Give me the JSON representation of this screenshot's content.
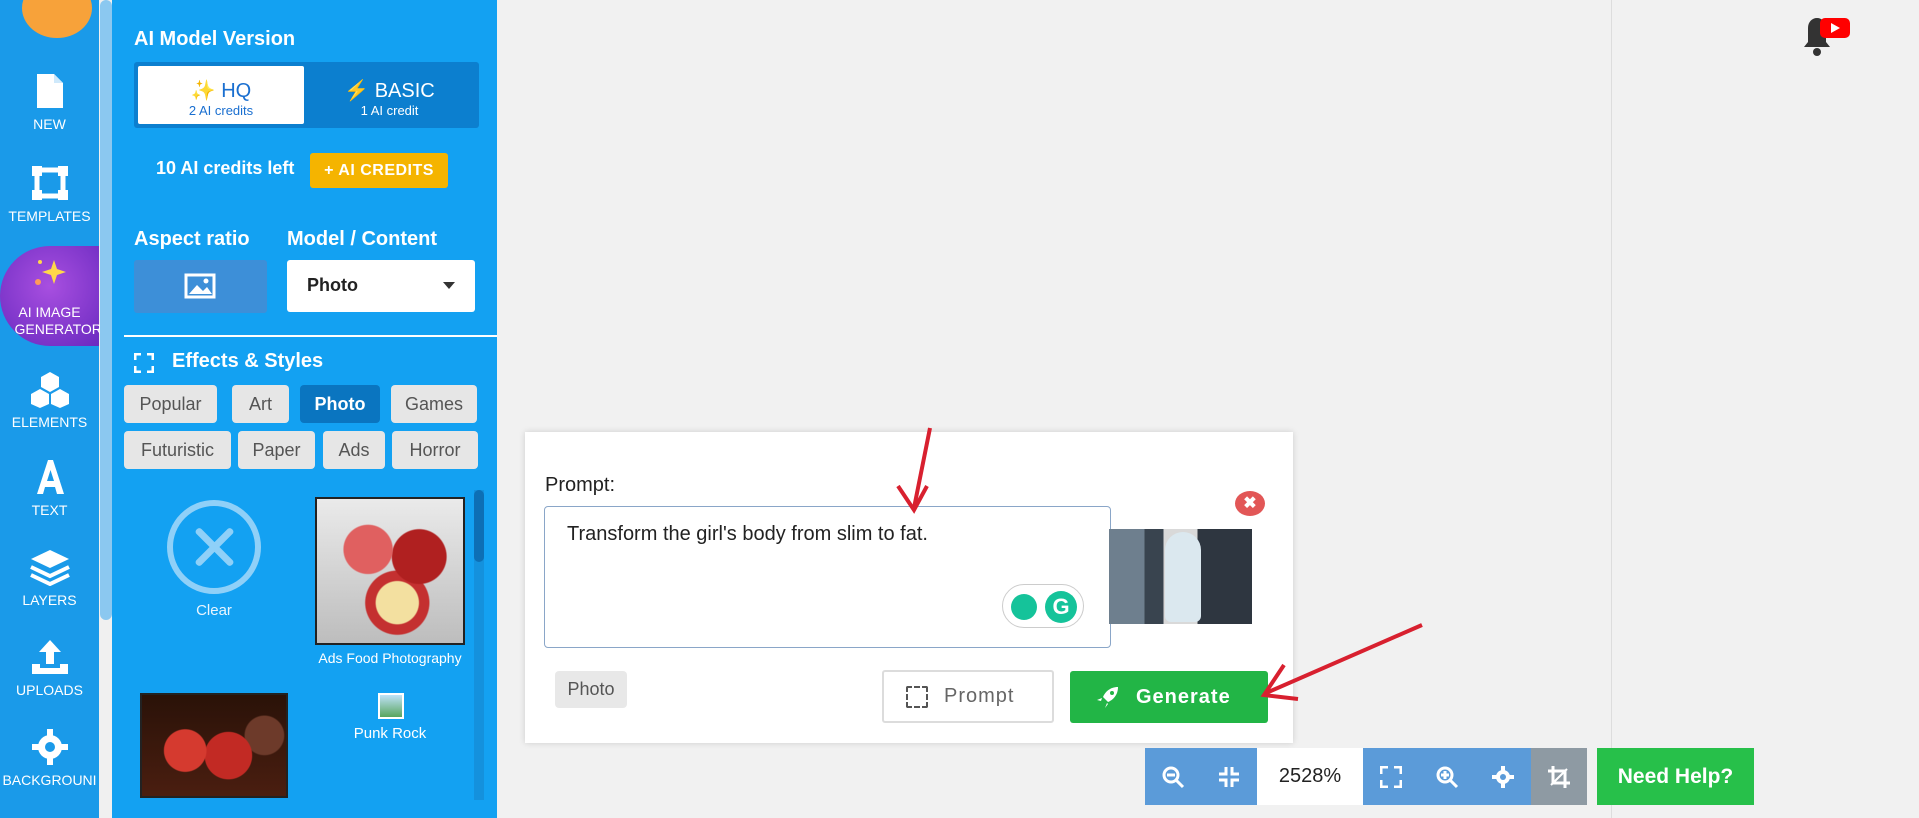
{
  "rail": {
    "items": [
      {
        "label": "NEW",
        "icon": "file-icon"
      },
      {
        "label": "TEMPLATES",
        "icon": "templates-icon"
      },
      {
        "label": "AI IMAGE GENERATOR",
        "icon": "sparkle-icon"
      },
      {
        "label": "ELEMENTS",
        "icon": "cubes-icon"
      },
      {
        "label": "TEXT",
        "icon": "text-icon"
      },
      {
        "label": "LAYERS",
        "icon": "layers-icon"
      },
      {
        "label": "UPLOADS",
        "icon": "upload-icon"
      },
      {
        "label": "BACKGROUNI",
        "icon": "gear-icon"
      }
    ]
  },
  "panel": {
    "model_heading": "AI Model Version",
    "hq": {
      "title": "HQ",
      "credits": "2 AI credits"
    },
    "basic": {
      "title": "BASIC",
      "credits": "1 AI credit"
    },
    "credits_left": "10 AI credits left",
    "ai_credits_button": "+ AI CREDITS",
    "aspect_heading": "Aspect ratio",
    "model_content_heading": "Model / Content",
    "model_select_value": "Photo",
    "effects_heading": "Effects & Styles",
    "pills_row1": [
      "Popular",
      "Art",
      "Photo",
      "Games"
    ],
    "pills_row2": [
      "Futuristic",
      "Paper",
      "Ads",
      "Horror"
    ],
    "gallery": {
      "clear_label": "Clear",
      "food_label": "Ads Food Photography",
      "punk_label": "Punk Rock"
    }
  },
  "modal": {
    "prompt_label": "Prompt:",
    "prompt_value": "Transform the girl's body from slim to fat.",
    "tag": "Photo",
    "prompt_button": "Prompt",
    "generate_button": "Generate",
    "close": "✖"
  },
  "toolbar": {
    "zoom_value": "2528%",
    "help_button": "Need Help?"
  },
  "colors": {
    "rail": "#1a9ae9",
    "panel": "#13a1f2",
    "accent_yellow": "#f5b400",
    "generate_green": "#22b546",
    "annotation_red": "#d8202f"
  }
}
